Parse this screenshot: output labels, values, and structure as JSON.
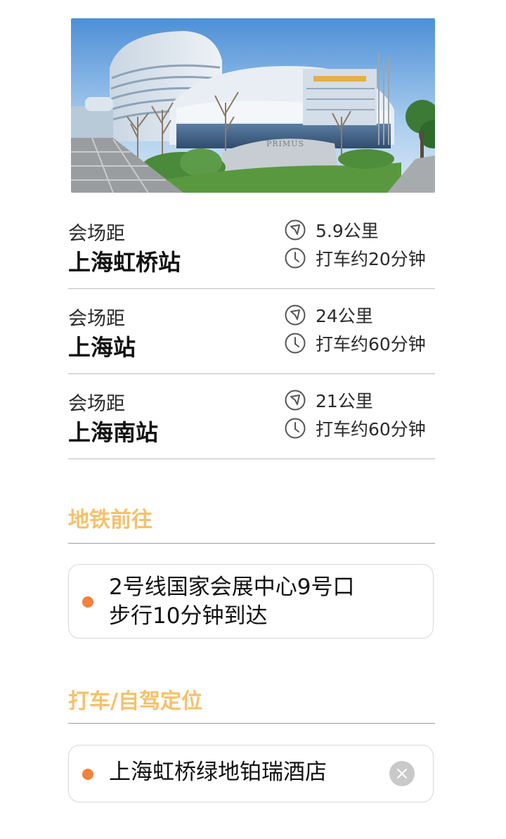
{
  "hero": {
    "sign_text": "PRIMUS"
  },
  "stations": [
    {
      "prefix": "会场距",
      "name": "上海虹桥站",
      "distance": "5.9公里",
      "time": "打车约20分钟"
    },
    {
      "prefix": "会场距",
      "name": "上海站",
      "distance": "24公里",
      "time": "打车约60分钟"
    },
    {
      "prefix": "会场距",
      "name": "上海南站",
      "distance": "21公里",
      "time": "打车约60分钟"
    }
  ],
  "metro": {
    "title": "地铁前往",
    "line1": "2号线国家会展中心9号口",
    "line2": "步行10分钟到达"
  },
  "drive": {
    "title": "打车/自驾定位",
    "location": "上海虹桥绿地铂瑞酒店"
  },
  "icons": {
    "distance": "navigation-arrow-icon",
    "time": "clock-icon",
    "clear": "close-icon"
  },
  "colors": {
    "accent_title": "#f6c16a",
    "bullet": "#f2823c",
    "clear_button": "#c9c9c9"
  }
}
